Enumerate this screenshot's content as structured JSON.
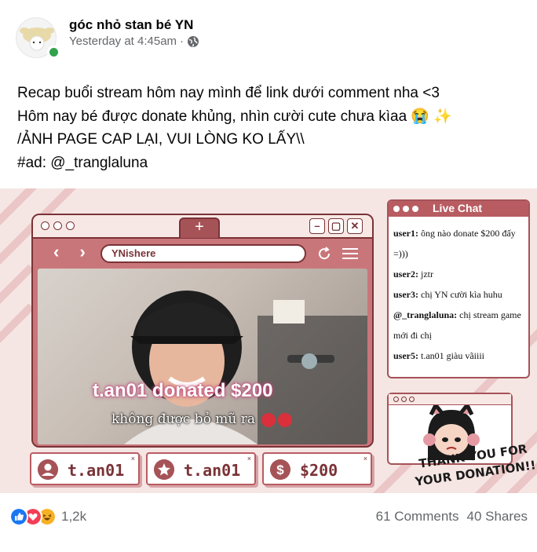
{
  "post": {
    "page_name": "góc nhỏ stan bé YN",
    "timestamp": "Yesterday at 4:45am",
    "separator": "·",
    "privacy_icon": "globe-icon"
  },
  "caption": {
    "line1": "Recap buổi stream hôm nay mình để link dưới comment nha <3",
    "line2": "Hôm nay bé được donate khủng, nhìn cười cute chưa kìaa 😭 ✨",
    "line3": "/ẢNH PAGE CAP LẠI, VUI LÒNG KO LẤY\\\\",
    "line4": "#ad: @_tranglaluna"
  },
  "image": {
    "browser": {
      "tab_plus": "+",
      "url": "YNishere",
      "nav_arrows": "‹ ›"
    },
    "video": {
      "donation_text": "t.an01 donated $200",
      "subtitle": "không được bỏ mũ ra"
    },
    "cards": [
      {
        "icon": "user-icon",
        "text": "t.an01"
      },
      {
        "icon": "star-icon",
        "text": "t.an01"
      },
      {
        "icon": "dollar-icon",
        "text": "$200"
      }
    ],
    "live_chat": {
      "title": "Live Chat",
      "messages": [
        {
          "user": "user1:",
          "text": "ông nào donate $200 đấy =)))"
        },
        {
          "user": "user2:",
          "text": "jztr"
        },
        {
          "user": "user3:",
          "text": "chị YN cười kìa huhu"
        },
        {
          "user": "@_tranglaluna:",
          "text": "chị stream game mới đi chị"
        },
        {
          "user": "user5:",
          "text": "t.an01 giàu vãiiii"
        }
      ]
    },
    "thanks": {
      "line1": "THANK YOU FOR",
      "line2": "YOUR DONATION!!"
    }
  },
  "footer": {
    "reaction_count": "1,2k",
    "comments": "61 Comments",
    "shares": "40 Shares"
  },
  "colors": {
    "accent": "#b85c62",
    "dark_accent": "#7a3337",
    "background": "#f5e6e4",
    "like_blue": "#1877f2",
    "love_red": "#f33e58",
    "haha_yellow": "#f7b125"
  }
}
